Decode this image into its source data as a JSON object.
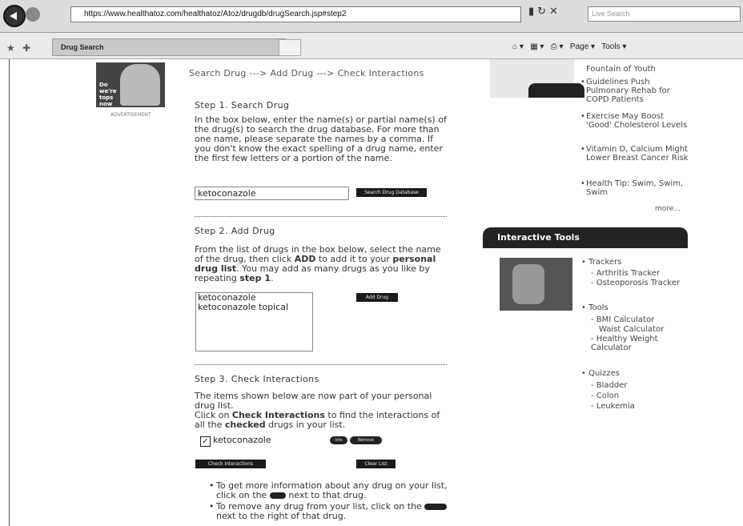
{
  "browser": {
    "url": "https://www.healthatoz.com/healthatoz/Atoz/drugdb/drugSearch.jsp#step2",
    "search_placeholder": "Live Search",
    "tab_title": "Drug Search",
    "page_label": "Page",
    "tools_label": "Tools"
  },
  "breadcrumb": "Search Drug ---> Add Drug ---> Check Interactions",
  "step1": {
    "title": "Step 1. Search Drug",
    "instructions": "In the box below, enter the name(s) or partial name(s) of the drug(s) to search the drug database. For more than one name, please separate the names by a comma. If you don't know the exact spelling of a drug name, enter the first few letters or a portion of the name.",
    "input_value": "ketoconazole",
    "button_label": "Search Drug Database"
  },
  "step2": {
    "title": "Step 2. Add Drug",
    "instructions_html_free": "From the list of drugs in the box below, select the name of the drug, then click ADD to add it to your personal drug list. You may add as many drugs as you like by repeating step 1.",
    "options": [
      "ketoconazole",
      "ketoconazole topical"
    ],
    "button_label": "Add Drug"
  },
  "step3": {
    "title": "Step 3. Check Interactions",
    "line1": "The items shown below are now part of your personal drug list.",
    "line2": "Click on Check Interactions to find the interactions of all the checked drugs in your list.",
    "drug_name": "ketoconazole",
    "info_label": "Info",
    "remove_label": "Remove",
    "check_button": "Check Interactions",
    "clear_button": "Clear List",
    "tip1": "To get more information about any drug on your list, click on the",
    "tip1_end": "next to that drug.",
    "tip2": "To remove any drug from your list, click on the",
    "tip2_end": "next to the right of that drug."
  },
  "promo": {
    "text": "Do we're tops now",
    "caption": "ADVERTISEMENT"
  },
  "news": {
    "items": [
      "Fountain of Youth",
      "Guidelines Push Pulmonary Rehab for COPD Patients",
      "Exercise May Boost 'Good' Cholesterol Levels",
      "Vitamin D, Calcium Might Lower Breast Cancer Risk",
      "Health Tip: Swim, Swim, Swim"
    ],
    "more": "more..."
  },
  "tools_panel": {
    "title": "Interactive Tools",
    "trackers_label": "Trackers",
    "trackers": [
      "Arthritis Tracker",
      "Osteoporosis Tracker"
    ],
    "tools_label": "Tools",
    "tools": [
      "BMI Calculator",
      "Waist Calculator",
      "Healthy Weight Calculator"
    ],
    "quizzes_label": "Quizzes",
    "quizzes": [
      "Bladder",
      "Colon",
      "Leukemia"
    ]
  }
}
